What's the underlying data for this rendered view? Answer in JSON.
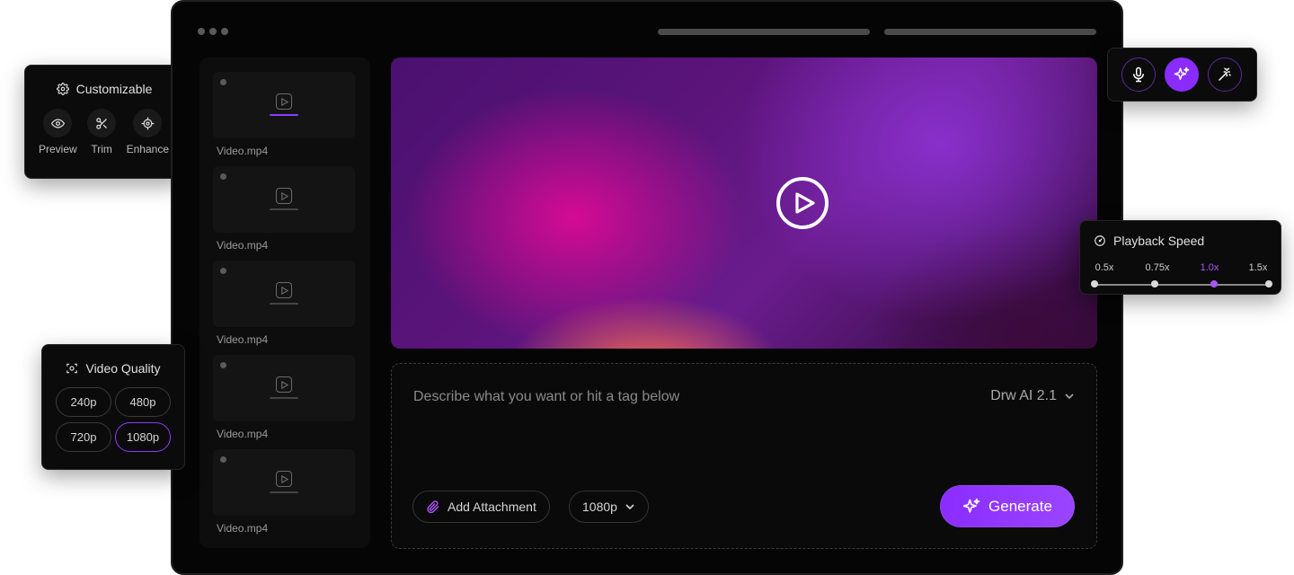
{
  "videos": [
    {
      "name": "Video.mp4",
      "active": true
    },
    {
      "name": "Video.mp4",
      "active": false
    },
    {
      "name": "Video.mp4",
      "active": false
    },
    {
      "name": "Video.mp4",
      "active": false
    },
    {
      "name": "Video.mp4",
      "active": false
    }
  ],
  "prompt": {
    "placeholder": "Describe what you want or hit a tag below",
    "model": "Drw AI 2.1",
    "attachment_label": "Add Attachment",
    "resolution": "1080p",
    "generate_label": "Generate"
  },
  "customizable": {
    "title": "Customizable",
    "tools": [
      {
        "label": "Preview",
        "icon": "eye-icon"
      },
      {
        "label": "Trim",
        "icon": "scissors-icon"
      },
      {
        "label": "Enhance",
        "icon": "crosshair-icon"
      }
    ]
  },
  "video_quality": {
    "title": "Video Quality",
    "options": [
      "240p",
      "480p",
      "720p",
      "1080p"
    ],
    "selected": "1080p"
  },
  "voice_tools": {
    "icons": [
      "microphone-icon",
      "sparkle-icon",
      "magic-wand-icon"
    ],
    "active": "sparkle-icon"
  },
  "playback_speed": {
    "title": "Playback Speed",
    "options": [
      "0.5x",
      "0.75x",
      "1.0x",
      "1.5x"
    ],
    "selected": "1.0x"
  },
  "colors": {
    "accent": "#8a2cff",
    "accent_light": "#a855f7",
    "window_bg": "#050505"
  }
}
